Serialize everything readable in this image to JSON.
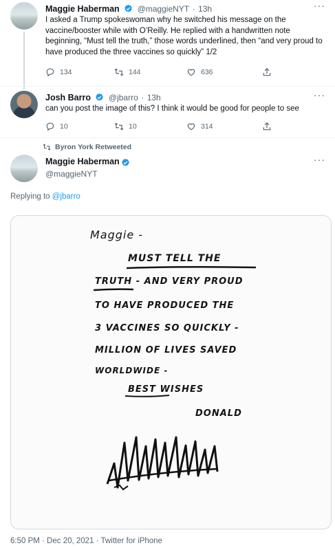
{
  "tweet1": {
    "name": "Maggie Haberman",
    "handle": "@maggieNYT",
    "time": "13h",
    "text": "I asked a Trump spokeswoman why he switched his message on the vaccine/booster while with O’Reilly. He replied with a handwritten note beginning, “Must tell the truth,” those words underlined, then “and very proud to have produced the three vaccines so quickly” 1/2",
    "replies": "134",
    "retweets": "144",
    "likes": "636"
  },
  "tweet2": {
    "name": "Josh Barro",
    "handle": "@jbarro",
    "time": "13h",
    "text": "can you post the image of this? I think it would be good for people to see",
    "replies": "10",
    "retweets": "10",
    "likes": "314"
  },
  "retweet_context": "Byron York Retweeted",
  "main_tweet": {
    "name": "Maggie Haberman",
    "handle": "@maggieNYT",
    "replying_label": "Replying to ",
    "replying_handle": "@jbarro",
    "timestamp": "6:50 PM · Dec 20, 2021 · Twitter for iPhone"
  },
  "note": {
    "line1": "Maggie -",
    "line2": "MUST TELL THE",
    "line3": "TRUTH - AND VERY PROUD",
    "line4": "TO HAVE PRODUCED THE",
    "line5": "3 VACCINES SO QUICKLY -",
    "line6": "MILLION OF LIVES SAVED",
    "line7": "WORLDWIDE -",
    "line8": "BEST WISHES",
    "line9": "DONALD"
  },
  "colors": {
    "accent": "#1d9bf0",
    "muted": "#536471"
  },
  "icons": [
    "verified-icon",
    "more-icon",
    "reply-icon",
    "retweet-icon",
    "like-icon",
    "share-icon"
  ]
}
